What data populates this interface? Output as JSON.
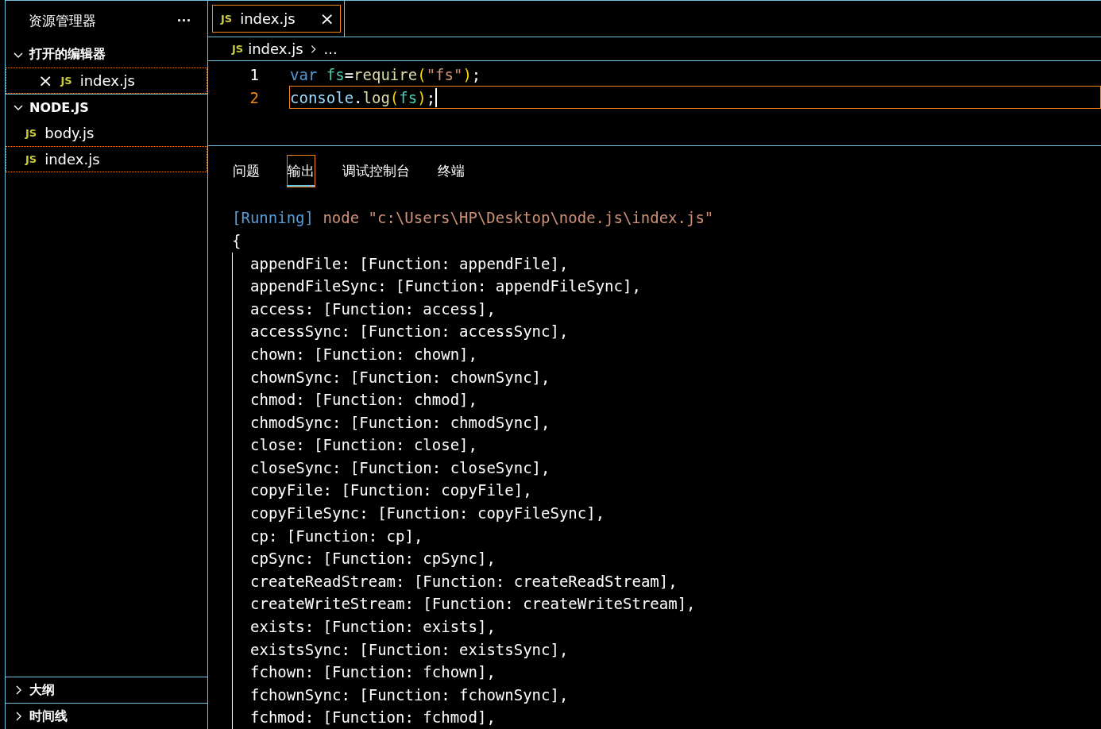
{
  "sidebar": {
    "title": "资源管理器",
    "more": "···",
    "sections": [
      {
        "label": "打开的编辑器",
        "expanded": true,
        "items": [
          {
            "label": "index.js",
            "badge": "JS",
            "close": "×",
            "selected": true
          }
        ]
      },
      {
        "label": "NODE.JS",
        "expanded": true,
        "items": [
          {
            "label": "body.js",
            "badge": "JS",
            "selected": false
          },
          {
            "label": "index.js",
            "badge": "JS",
            "selected": true
          }
        ]
      }
    ],
    "bottom_sections": [
      {
        "label": "大纲",
        "expanded": false
      },
      {
        "label": "时间线",
        "expanded": false
      }
    ]
  },
  "editor_tabs": [
    {
      "label": "index.js",
      "badge": "JS",
      "close": "×",
      "selected": true
    }
  ],
  "breadcrumb": {
    "badge": "JS",
    "file": "index.js",
    "rest": "..."
  },
  "code": [
    {
      "number": "1",
      "current": false,
      "tokens": [
        {
          "kind": "keyword",
          "text": "var"
        },
        {
          "kind": "variable",
          "text": "fs"
        },
        {
          "kind": "plain",
          "text": "="
        },
        {
          "kind": "function",
          "text": "require"
        },
        {
          "kind": "paren",
          "text": "("
        },
        {
          "kind": "string",
          "text": "\"fs\""
        },
        {
          "kind": "paren",
          "text": ")"
        },
        {
          "kind": "plain",
          "text": ";"
        }
      ]
    },
    {
      "number": "2",
      "current": true,
      "tokens": [
        {
          "kind": "object",
          "text": "console"
        },
        {
          "kind": "plain",
          "text": "."
        },
        {
          "kind": "function",
          "text": "log"
        },
        {
          "kind": "paren",
          "text": "("
        },
        {
          "kind": "variable",
          "text": "fs"
        },
        {
          "kind": "paren",
          "text": ")"
        },
        {
          "kind": "plain",
          "text": ";"
        }
      ]
    }
  ],
  "panel_tabs": [
    {
      "label": "问题",
      "selected": false
    },
    {
      "label": "输出",
      "selected": true
    },
    {
      "label": "调试控制台",
      "selected": false
    },
    {
      "label": "终端",
      "selected": false
    }
  ],
  "output": {
    "running_tag": "[Running]",
    "command": "node \"c:\\Users\\HP\\Desktop\\node.js\\index.js\"",
    "open_brace": "{",
    "lines": [
      "appendFile: [Function: appendFile],",
      "appendFileSync: [Function: appendFileSync],",
      "access: [Function: access],",
      "accessSync: [Function: accessSync],",
      "chown: [Function: chown],",
      "chownSync: [Function: chownSync],",
      "chmod: [Function: chmod],",
      "chmodSync: [Function: chmodSync],",
      "close: [Function: close],",
      "closeSync: [Function: closeSync],",
      "copyFile: [Function: copyFile],",
      "copyFileSync: [Function: copyFileSync],",
      "cp: [Function: cp],",
      "cpSync: [Function: cpSync],",
      "createReadStream: [Function: createReadStream],",
      "createWriteStream: [Function: createWriteStream],",
      "exists: [Function: exists],",
      "existsSync: [Function: existsSync],",
      "fchown: [Function: fchown],",
      "fchownSync: [Function: fchownSync],",
      "fchmod: [Function: fchmod],"
    ]
  }
}
